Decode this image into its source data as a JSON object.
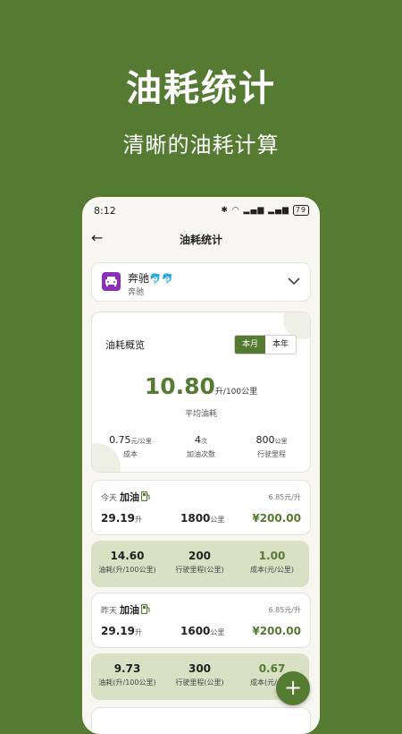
{
  "hero": {
    "title": "油耗统计",
    "subtitle": "清晰的油耗计算"
  },
  "status_bar": {
    "time": "8:12",
    "battery": "79"
  },
  "header": {
    "title": "油耗统计"
  },
  "vehicle": {
    "name": "奔驰",
    "emoji": "🐬🐬",
    "subtitle": "奔驰"
  },
  "overview": {
    "label": "油耗概览",
    "period_options": [
      "本月",
      "本年"
    ],
    "selected_period": "本月",
    "average_value": "10.80",
    "average_unit": "升/100公里",
    "average_label": "平均油耗",
    "stats": [
      {
        "value": "0.75",
        "unit": "元/公里",
        "label": "成本"
      },
      {
        "value": "4",
        "unit": "次",
        "label": "加油次数"
      },
      {
        "value": "800",
        "unit": "公里",
        "label": "行驶里程"
      }
    ]
  },
  "records": [
    {
      "day": "今天",
      "action": "加油",
      "price": "6.85元/升",
      "volume": "29.19",
      "volume_unit": "升",
      "distance": "1800",
      "distance_unit": "公里",
      "amount": "¥200.00",
      "summary": [
        {
          "value": "14.60",
          "label": "油耗(升/100公里)"
        },
        {
          "value": "200",
          "label": "行驶里程(公里)"
        },
        {
          "value": "1.00",
          "label": "成本(元/公里)"
        }
      ]
    },
    {
      "day": "昨天",
      "action": "加油",
      "price": "6.85元/升",
      "volume": "29.19",
      "volume_unit": "升",
      "distance": "1600",
      "distance_unit": "公里",
      "amount": "¥200.00",
      "summary": [
        {
          "value": "9.73",
          "label": "油耗(升/100公里)"
        },
        {
          "value": "300",
          "label": "行驶里程(公里)"
        },
        {
          "value": "0.67",
          "label": "成本(元/公里)"
        }
      ]
    }
  ],
  "fab": {
    "label": "+"
  },
  "colors": {
    "brand": "#557a32",
    "summary_bg": "#d9e0c4",
    "vehicle_icon": "#8b2fb8"
  }
}
